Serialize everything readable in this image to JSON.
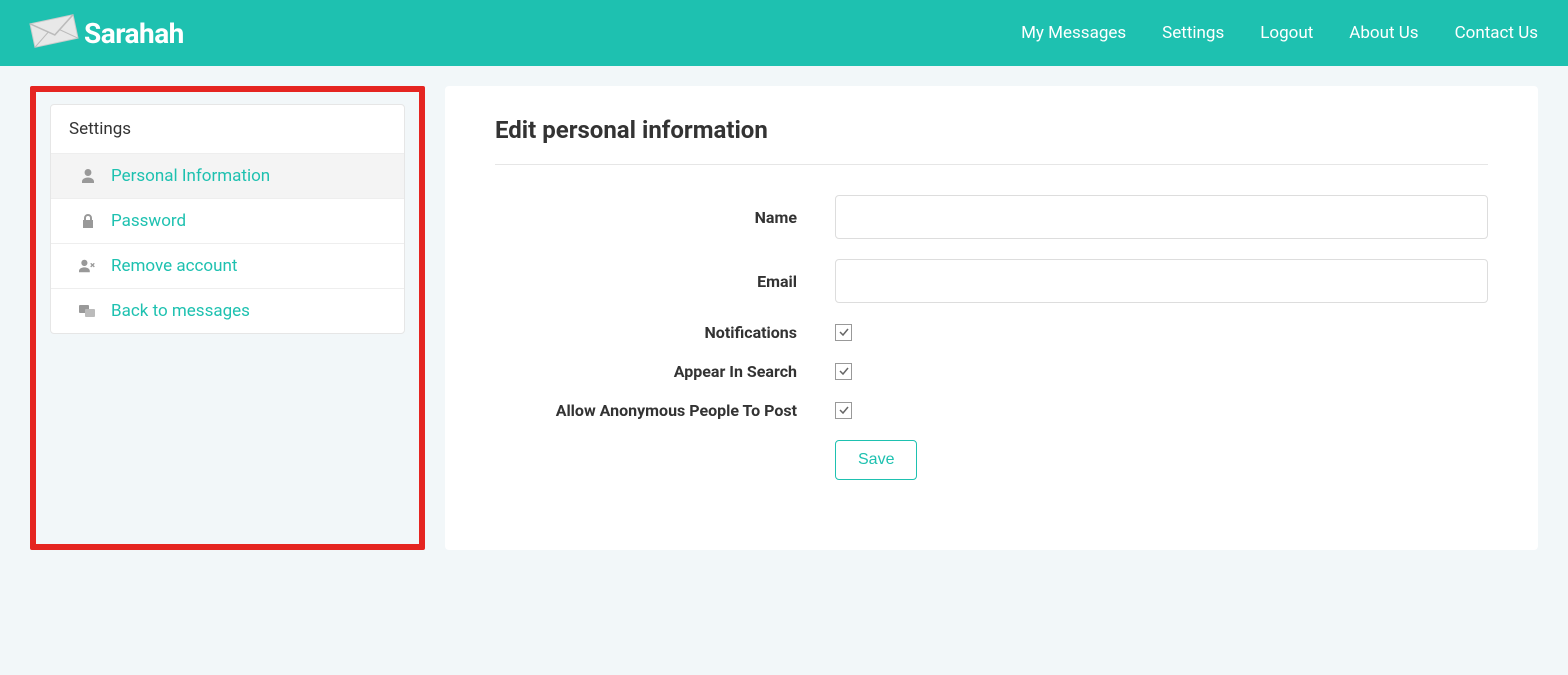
{
  "brand": "Sarahah",
  "nav": {
    "messages": "My Messages",
    "settings": "Settings",
    "logout": "Logout",
    "about": "About Us",
    "contact": "Contact Us"
  },
  "sidebar": {
    "header": "Settings",
    "items": {
      "personal": "Personal Information",
      "password": "Password",
      "remove": "Remove account",
      "back": "Back to messages"
    }
  },
  "form": {
    "title": "Edit personal information",
    "name_label": "Name",
    "name_value": "",
    "email_label": "Email",
    "email_value": "",
    "notifications_label": "Notifications",
    "notifications_checked": true,
    "appear_search_label": "Appear In Search",
    "appear_search_checked": true,
    "anon_post_label": "Allow Anonymous People To Post",
    "anon_post_checked": true,
    "save_label": "Save"
  }
}
